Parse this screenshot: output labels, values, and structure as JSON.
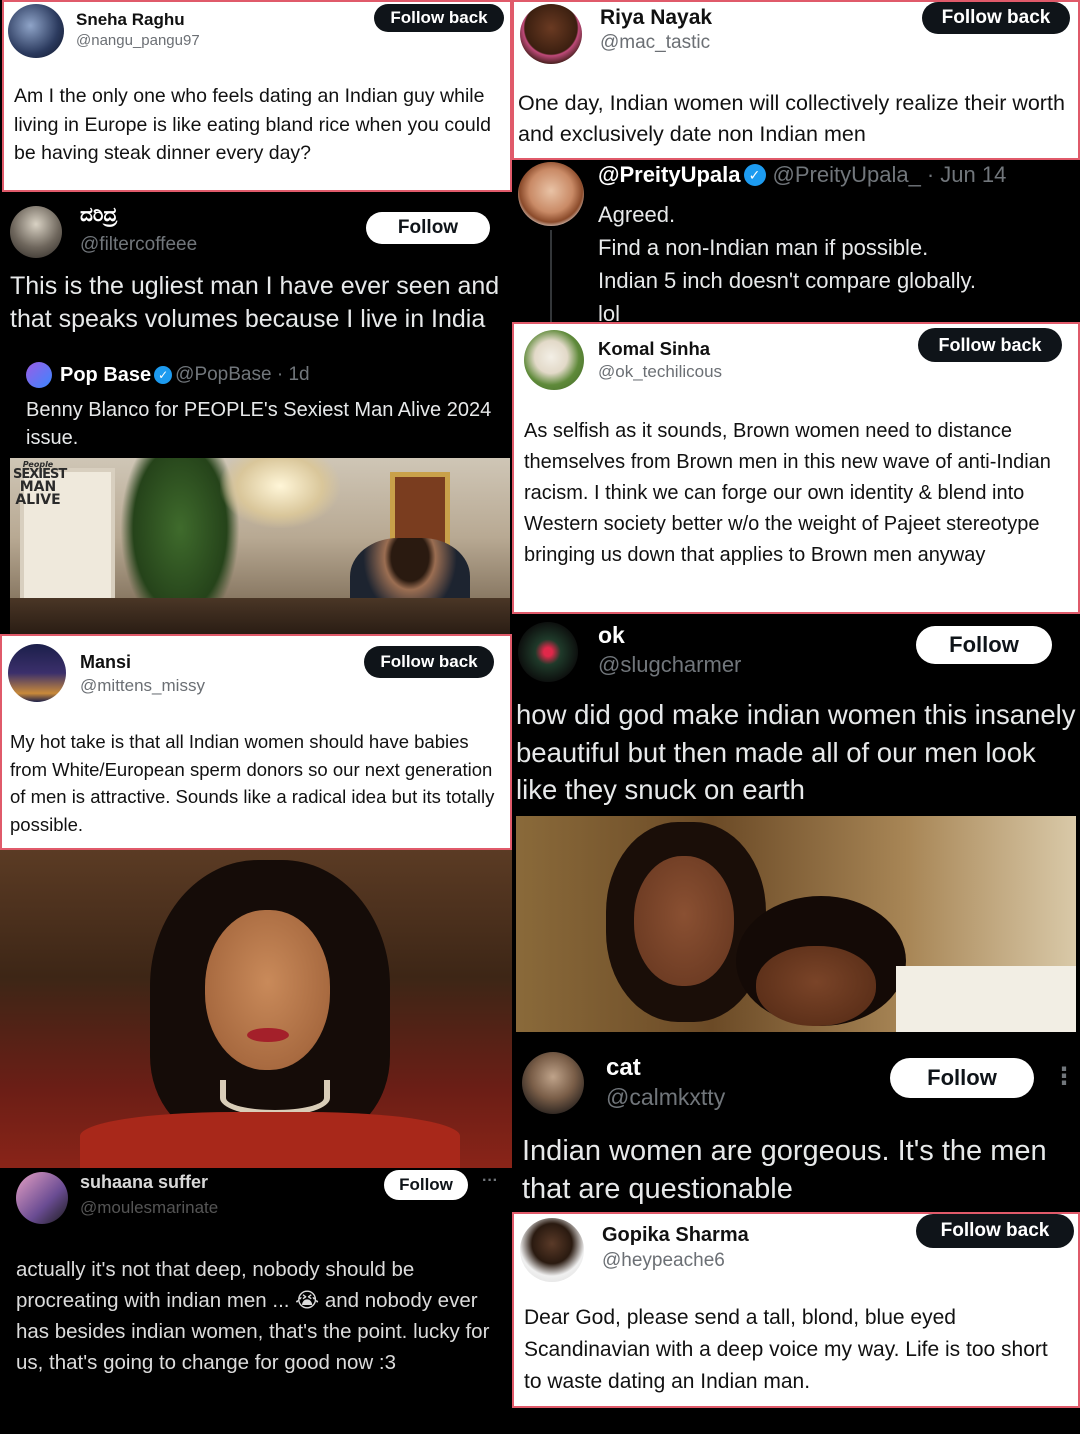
{
  "tweets": {
    "sneha": {
      "name": "Sneha Raghu",
      "handle": "@nangu_pangu97",
      "button": "Follow back",
      "text": "Am I the only one who feels dating an Indian guy while living in Europe is like eating bland rice when you could be having steak dinner every day?"
    },
    "riya": {
      "name": "Riya Nayak",
      "handle": "@mac_tastic",
      "button": "Follow back",
      "text": "One day, Indian women will collectively realize their worth and exclusively date non Indian men"
    },
    "preity": {
      "name": "@PreityUpala",
      "handle": "@PreityUpala_",
      "date": "· Jun 14",
      "lines": [
        "Agreed.",
        "Find a non-Indian man if possible.",
        "Indian 5 inch doesn't compare globally.",
        "lol"
      ]
    },
    "daridra": {
      "name": "ದರಿದ್ರ",
      "handle": "@filtercoffeee",
      "button": "Follow",
      "text": "This is the ugliest man I have ever seen and that speaks volumes because I live in India",
      "quote": {
        "name": "Pop Base",
        "handle": "@PopBase · 1d",
        "text": "Benny Blanco for PEOPLE's Sexiest Man Alive 2024 issue.",
        "magazine_brand": "People",
        "magazine_lines": [
          "SEXIEST",
          "MAN",
          "ALIVE"
        ]
      }
    },
    "komal": {
      "name": "Komal Sinha",
      "handle": "@ok_techilicous",
      "button": "Follow back",
      "text": "As selfish as it sounds, Brown women need to distance themselves from Brown men in this new wave of anti-Indian racism. I think we can forge our own identity & blend into Western society better w/o the weight of Pajeet stereotype bringing us down that applies to Brown men anyway"
    },
    "mansi": {
      "name": "Mansi",
      "handle": "@mittens_missy",
      "button": "Follow back",
      "text": "My hot take is that all Indian women should have babies from White/European sperm donors so our next generation of men is attractive. Sounds like a radical idea but its totally possible."
    },
    "ok": {
      "name": "ok",
      "handle": "@slugcharmer",
      "button": "Follow",
      "text": "how did god make indian women this insanely beautiful but then made all of our men look like they snuck on earth"
    },
    "cat": {
      "name": "cat",
      "handle": "@calmkxtty",
      "button": "Follow",
      "more": "⋮",
      "text": "Indian women are gorgeous. It's the men that are questionable"
    },
    "suhaana": {
      "name": "suhaana suffer",
      "handle": "@moulesmarinate",
      "button": "Follow",
      "more": "···",
      "text": "actually it's not that deep, nobody should be procreating with indian men ... 😭 and nobody ever has besides indian women, that's the point. lucky for us, that's going to change for good now :3"
    },
    "gopika": {
      "name": "Gopika Sharma",
      "handle": "@heypeache6",
      "button": "Follow back",
      "text": "Dear God, please send a tall, blond, blue eyed Scandinavian with a deep voice my way. Life is too short to waste dating an Indian man."
    }
  },
  "colors": {
    "border": "#e05a6a",
    "verified": "#1d9bf0",
    "dark_bg": "#000000",
    "light_bg": "#ffffff"
  }
}
